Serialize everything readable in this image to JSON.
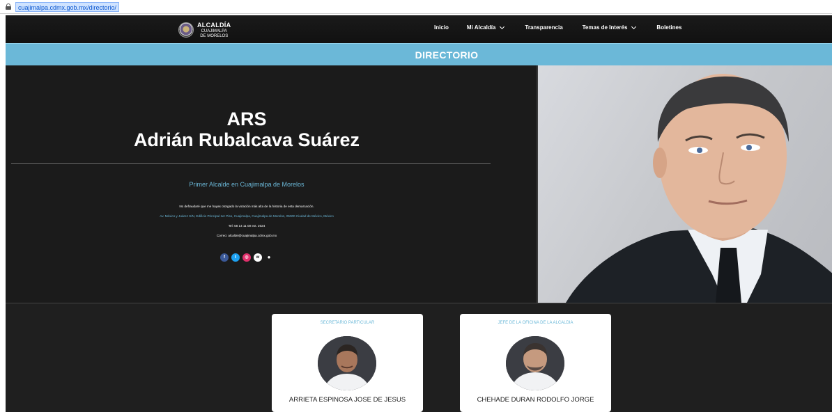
{
  "browser": {
    "url": "cuajimalpa.cdmx.gob.mx/directorio/"
  },
  "header": {
    "logo": {
      "line1": "ALCALDÍA",
      "line2": "CUAJIMALPA",
      "line3": "DE MORELOS"
    },
    "nav": [
      {
        "label": "Inicio",
        "dropdown": false
      },
      {
        "label": "Mi Alcaldía",
        "dropdown": true
      },
      {
        "label": "Transparencia",
        "dropdown": false
      },
      {
        "label": "Temas de Interés",
        "dropdown": true
      },
      {
        "label": "Boletines",
        "dropdown": false
      }
    ]
  },
  "banner": {
    "title": "DIRECTORIO"
  },
  "hero": {
    "initials": "ARS",
    "name": "Adrián Rubalcava Suárez",
    "role": "Primer Alcalde en Cuajimalpa de Morelos",
    "quote": "No defraudaré que me hayas otorgado la votación más alta de la historia de esta demarcación.",
    "address": "Av. México y Juárez S/N, Edificio Principal 1er Piso, Cuajimalpa, Cuajimalpa de Morelos, 05000 Ciudad de México, México",
    "tel": "Tel: 58 14 11 00  ext. 2024",
    "email": "Correo: alcalde@cuajimalpa.cdmx.gob.mx",
    "socials": [
      "facebook-icon",
      "twitter-icon",
      "instagram-icon",
      "whatsapp-icon",
      "user-icon"
    ]
  },
  "staff": [
    {
      "title": "SECRETARIO PARTICULAR",
      "name": "ARRIETA ESPINOSA JOSE DE JESUS"
    },
    {
      "title": "JEFE DE LA OFICINA DE LA ALCALDIA",
      "name": "CHEHADE DURAN RODOLFO JORGE"
    }
  ],
  "colors": {
    "accent": "#6bb8d8",
    "background": "#1f1f1f",
    "header": "#111111"
  }
}
